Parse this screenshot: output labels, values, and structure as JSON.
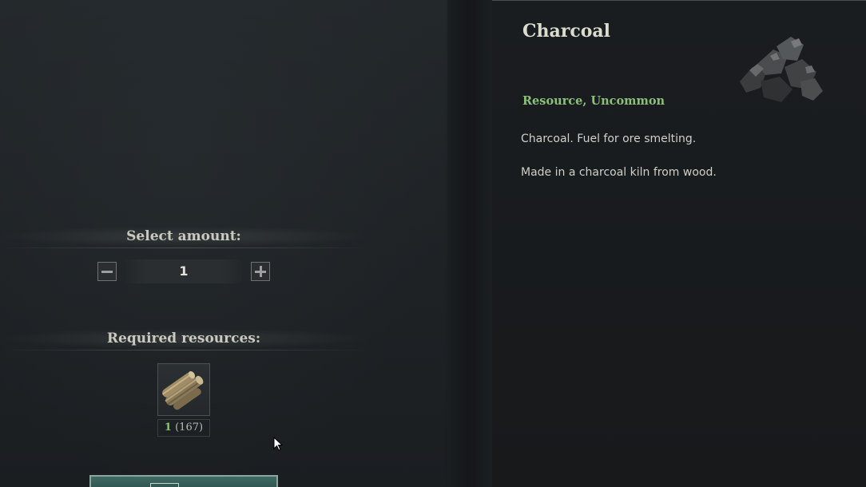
{
  "amount_section": {
    "header": "Select amount:",
    "value": "1",
    "decrease_icon": "minus-icon",
    "increase_icon": "plus-icon"
  },
  "resources_section": {
    "header": "Required resources:",
    "items": [
      {
        "icon": "wood-log-icon",
        "required": "1",
        "owned": "(167)"
      }
    ]
  },
  "item": {
    "name": "Charcoal",
    "category": "Resource, Uncommon",
    "description": "Charcoal. Fuel for ore smelting.",
    "source": "Made in a charcoal kiln from wood.",
    "icon": "charcoal-icon"
  },
  "colors": {
    "category": "#8cc07a",
    "owned_count": "#86c76f",
    "craft_button": "#3f6b64"
  }
}
